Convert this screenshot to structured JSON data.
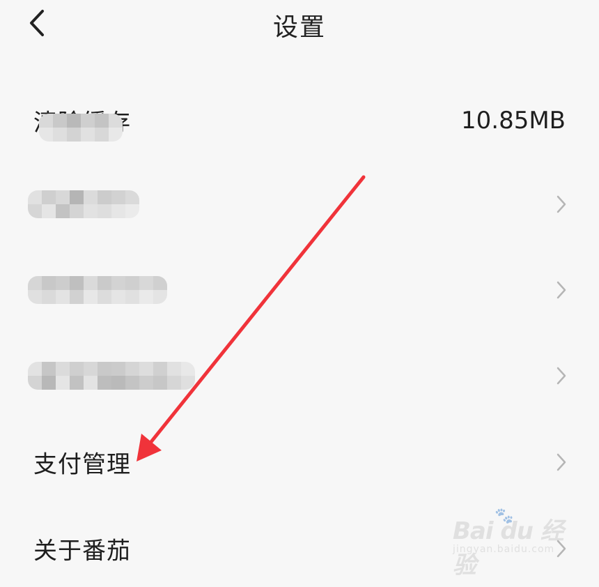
{
  "header": {
    "title": "设置",
    "back_icon": "chevron-left-icon"
  },
  "rows": [
    {
      "label": "清除缓存",
      "value": "10.85MB",
      "obscured": false
    },
    {
      "label": "",
      "obscured": true
    },
    {
      "label": "",
      "obscured": true
    },
    {
      "label": "",
      "obscured": true
    },
    {
      "label": "支付管理",
      "obscured": false
    },
    {
      "label": "关于番茄",
      "obscured": false
    }
  ],
  "watermark": {
    "brand": "Bai du 经验",
    "url": "jingyan.baidu.com"
  },
  "colors": {
    "background": "#f7f7f7",
    "text": "#1e1e1e",
    "chevron": "#b5b5b5",
    "annotation_arrow": "#f0333a"
  }
}
